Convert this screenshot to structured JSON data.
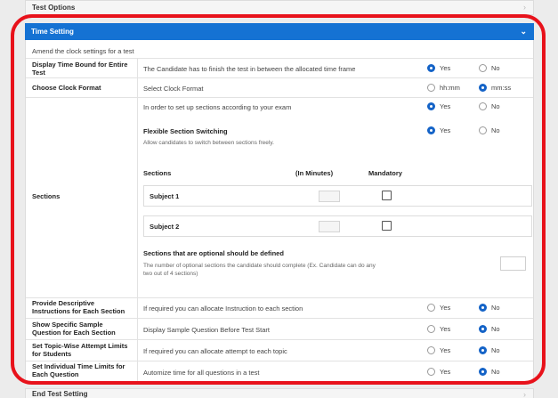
{
  "test_options": {
    "title": "Test Options"
  },
  "time_setting": {
    "title": "Time Setting",
    "subtitle": "Amend the clock settings for a test",
    "rows": {
      "display_bound": {
        "label": "Display Time Bound for Entire Test",
        "desc": "The Candidate has to finish the test in between the allocated time frame",
        "opt1": "Yes",
        "opt2": "No",
        "selected": "Yes"
      },
      "clock_format": {
        "label": "Choose Clock Format",
        "desc": "Select Clock Format",
        "opt1": "hh:mm",
        "opt2": "mm:ss",
        "selected": "mm:ss"
      },
      "sections": {
        "label": "Sections",
        "desc": "In order to set up sections according to your exam",
        "opt1": "Yes",
        "opt2": "No",
        "selected": "Yes",
        "flex_title": "Flexible Section Switching",
        "flex_note": "Allow candidates to switch between sections freely.",
        "flex_opt1": "Yes",
        "flex_opt2": "No",
        "flex_selected": "Yes",
        "col_sections": "Sections",
        "col_minutes": "(In Minutes)",
        "col_mandatory": "Mandatory",
        "subjects": [
          {
            "name": "Subject 1",
            "mandatory": false
          },
          {
            "name": "Subject 2",
            "mandatory": false
          }
        ],
        "optional_title": "Sections that are optional should be defined",
        "optional_note": "The number of optional sections the candidate should complete (Ex. Candidate can do any two out of 4 sections)"
      },
      "descriptive": {
        "label": "Provide Descriptive Instructions for Each Section",
        "desc": "If required you can allocate Instruction to each section",
        "opt1": "Yes",
        "opt2": "No",
        "selected": "No"
      },
      "sample_question": {
        "label": "Show Specific Sample Question for Each Section",
        "desc": "Display Sample Question Before Test Start",
        "opt1": "Yes",
        "opt2": "No",
        "selected": "No"
      },
      "topic_limits": {
        "label": "Set Topic-Wise Attempt Limits for Students",
        "desc": "If required you can allocate attempt to each topic",
        "opt1": "Yes",
        "opt2": "No",
        "selected": "No"
      },
      "individual_limits": {
        "label": "Set Individual Time Limits for Each Question",
        "desc": "Automize time for all questions in a test",
        "opt1": "Yes",
        "opt2": "No",
        "selected": "No"
      }
    }
  },
  "end_test": {
    "title": "End Test Setting"
  },
  "colors": {
    "accent": "#1572d3",
    "highlight": "#e8121b"
  },
  "icons": {
    "collapse": "chevron-right-icon",
    "expand": "chevron-down-icon"
  }
}
